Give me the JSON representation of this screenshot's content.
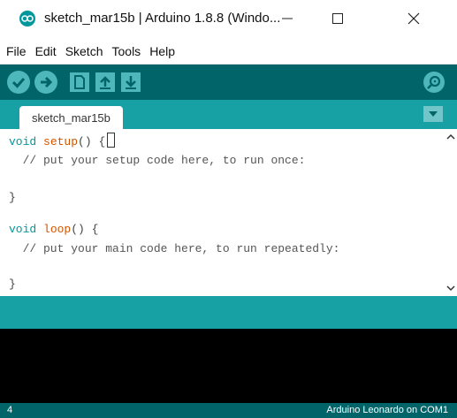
{
  "window": {
    "title": "sketch_mar15b | Arduino 1.8.8 (Windo...",
    "minimize_glyph": "—",
    "maximize_glyph": "☐",
    "close_glyph": "✕"
  },
  "menu": {
    "items": [
      "File",
      "Edit",
      "Sketch",
      "Tools",
      "Help"
    ]
  },
  "toolbar": {
    "icons": [
      "verify-icon",
      "upload-icon",
      "new-icon",
      "open-icon",
      "save-icon",
      "serial-monitor-icon"
    ]
  },
  "tabs": {
    "active": "sketch_mar15b"
  },
  "editor": {
    "lines": [
      {
        "type": "void",
        "fn": "setup",
        "rest": "() {"
      },
      {
        "comment": "  // put your setup code here, to run once:"
      },
      {
        "blank": ""
      },
      {
        "plain": "}"
      },
      {
        "blank": ""
      },
      {
        "type": "void",
        "fn": "loop",
        "rest": "() {"
      },
      {
        "comment": "  // put your main code here, to run repeatedly:"
      },
      {
        "blank": ""
      },
      {
        "plain": "}"
      }
    ]
  },
  "status": {
    "line_number": "4",
    "board": "Arduino Leonardo on COM1"
  },
  "colors": {
    "toolbar": "#006468",
    "tabstrip": "#17a1a5",
    "button": "#4db7bb",
    "keyword": "#00979c",
    "function": "#d35400"
  }
}
